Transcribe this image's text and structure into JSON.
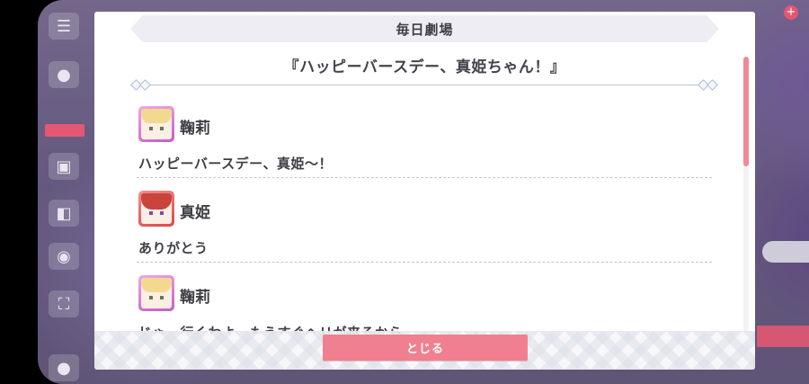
{
  "modal": {
    "header_title": "毎日劇場",
    "story_title": "『ハッピーバースデー、真姫ちゃん！』",
    "close_label": "とじる"
  },
  "dialog": [
    {
      "speaker": "鞠莉",
      "text": "ハッピーバースデー、真姫〜！",
      "avatar": "mari-avatar"
    },
    {
      "speaker": "真姫",
      "text": "ありがとう",
      "avatar": "maki-avatar"
    },
    {
      "speaker": "鞠莉",
      "text": "じゃ、行くわよ。もうすぐヘリが来るから",
      "avatar": "mari-avatar"
    }
  ],
  "scroll": {
    "position": 0,
    "visible_fraction": 0.4
  },
  "colors": {
    "accent": "#f0808f",
    "mari_frame": "#d77fd6",
    "maki_frame": "#e06a66",
    "text": "#3e3e44"
  },
  "side_menu": {
    "icons": [
      "menu-icon",
      "chat-icon",
      "gift-icon",
      "present-icon",
      "camera-icon",
      "fullscreen-icon",
      "user-icon"
    ]
  }
}
